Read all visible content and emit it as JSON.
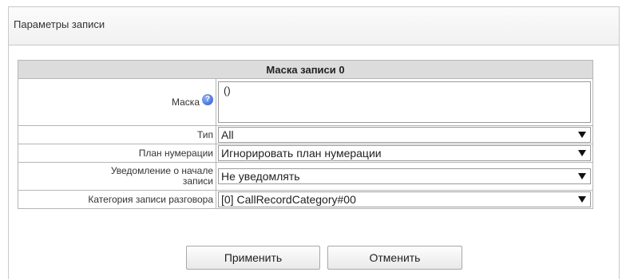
{
  "panel": {
    "title": "Параметры записи"
  },
  "table": {
    "title": "Маска записи 0"
  },
  "fields": {
    "mask": {
      "label": "Маска",
      "value": "()"
    },
    "type": {
      "label": "Тип",
      "value": "All"
    },
    "numbering_plan": {
      "label": "План нумерации",
      "value": "Игнорировать план нумерации"
    },
    "notify": {
      "label_line1": "Уведомление о начале",
      "label_line2": "записи",
      "value": "Не уведомлять"
    },
    "category": {
      "label": "Категория записи разговора",
      "value": "[0] CallRecordCategory#00"
    }
  },
  "buttons": {
    "apply": "Применить",
    "cancel": "Отменить"
  },
  "icons": {
    "help": "help-icon",
    "dropdown": "chevron-down-icon"
  },
  "colors": {
    "title_row_bg": "#dcdcdc",
    "help_icon": "#2a55c8"
  }
}
